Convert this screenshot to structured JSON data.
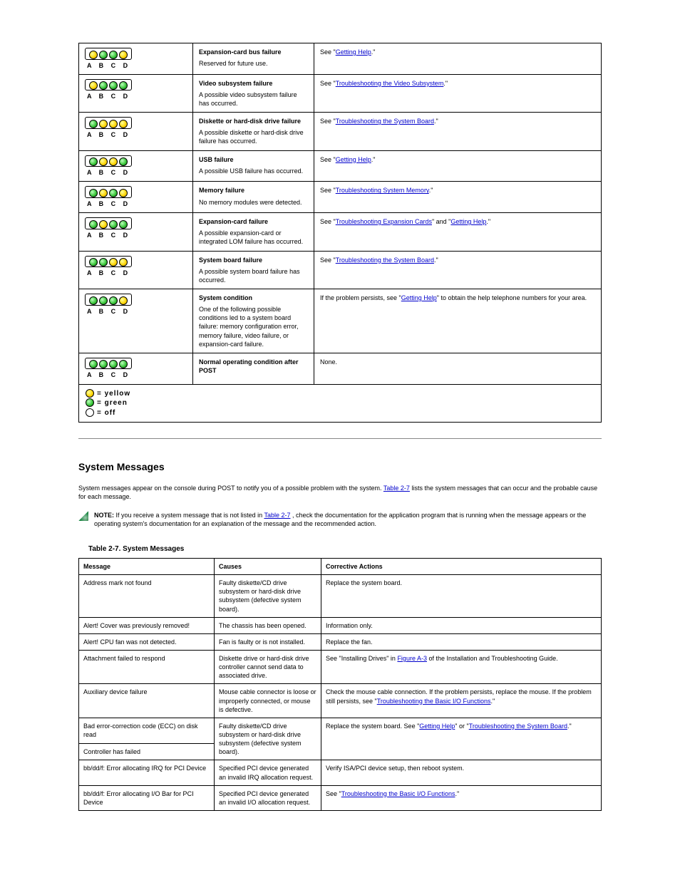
{
  "diag_table": {
    "legend": {
      "yellow": "= yellow",
      "green": "= green",
      "off": "= off"
    },
    "rows": [
      {
        "leds": [
          "y",
          "g",
          "g",
          "y"
        ],
        "cause_title": "Expansion-card bus failure",
        "cause_body": "Reserved for future use.",
        "action": {
          "pre": "See \"",
          "link": "Getting Help",
          "post": ".\""
        }
      },
      {
        "leds": [
          "y",
          "g",
          "g",
          "g"
        ],
        "cause_title": "Video subsystem failure",
        "cause_body": "A possible video subsystem failure has occurred.",
        "action": {
          "pre": "See \"",
          "link": "Troubleshooting the Video Subsystem",
          "post": ".\""
        }
      },
      {
        "leds": [
          "g",
          "y",
          "y",
          "y"
        ],
        "cause_title": "Diskette or hard-disk drive failure",
        "cause_body": "A possible diskette or hard-disk drive failure has occurred.",
        "action": {
          "pre": "See \"",
          "link": "Troubleshooting the System Board",
          "post": ".\""
        }
      },
      {
        "leds": [
          "g",
          "y",
          "y",
          "g"
        ],
        "cause_title": "USB failure",
        "cause_body": "A possible USB failure has occurred.",
        "action": {
          "pre": "See \"",
          "link": "Getting Help",
          "post": ".\""
        }
      },
      {
        "leds": [
          "g",
          "y",
          "g",
          "y"
        ],
        "cause_title": "Memory failure",
        "cause_body": "No memory modules were detected.",
        "action": {
          "pre": "See \"",
          "link": "Troubleshooting System Memory",
          "post": ".\""
        }
      },
      {
        "leds": [
          "g",
          "y",
          "g",
          "g"
        ],
        "cause_title": "Expansion-card failure",
        "cause_body": "A possible expansion-card or integrated LOM failure has occurred.",
        "action": {
          "pre": "See \"",
          "link": "Troubleshooting Expansion Cards",
          "link2": "Getting Help",
          "post2": ".\"",
          "mid": "\" and \""
        }
      },
      {
        "leds": [
          "g",
          "g",
          "y",
          "y"
        ],
        "cause_title": "System board failure",
        "cause_body": "A possible system board failure has occurred.",
        "action": {
          "pre": "See \"",
          "link": "Troubleshooting the System Board",
          "post": ".\""
        }
      },
      {
        "leds": [
          "g",
          "g",
          "g",
          "y"
        ],
        "cause_title": "System condition",
        "cause_body": "One of the following possible conditions led to a system board failure: memory configuration error, memory failure, video failure, or expansion-card failure.",
        "action": {
          "pre": "If the problem persists, see \"",
          "link": "Getting Help",
          "post_special": "\" to obtain the help telephone numbers for your area."
        }
      },
      {
        "leds": [
          "g",
          "g",
          "g",
          "g"
        ],
        "cause_title": "Normal operating condition after POST",
        "cause_body": "",
        "action_plain": "None."
      }
    ]
  },
  "section": {
    "title": "System Messages",
    "intro": {
      "pre": "System messages appear on the console during POST to notify you of a possible problem with the system. ",
      "mid": " lists the system messages that can occur and the probable cause for each message.",
      "link": "Table 2-7"
    },
    "note": {
      "label": "NOTE:",
      "pre": " If you receive a system message that is not listed in ",
      "link": "Table 2-7",
      "post": ", check the documentation for the application program that is running when the message appears or the operating system's documentation for an explanation of the message and the recommended action."
    },
    "table_caption": "Table 2-7. System Messages"
  },
  "msg_table": {
    "headers": {
      "msg": "Message",
      "cause": "Causes",
      "action": "Corrective Actions"
    },
    "rows": [
      {
        "msg": "Address mark not found",
        "cause_html": "Faulty diskette/CD drive subsystem or hard-disk drive subsystem (defective system board).",
        "action": "Replace the system board."
      },
      {
        "msg": "Alert! Cover was previously removed!",
        "cause_html": "The chassis has been opened.",
        "action": "Information only."
      },
      {
        "msg": "Alert! CPU fan was not detected.",
        "cause_html": "Fan is faulty or is not installed.",
        "action": "Replace the fan."
      },
      {
        "msg": "Attachment failed to respond",
        "cause_html": "Diskette drive or hard-disk drive controller cannot send data to associated drive.",
        "action": {
          "pre": "See \"Installing Drives\" in ",
          "link": "Figure A-3",
          "post": " of the Installation and Troubleshooting Guide."
        }
      },
      {
        "msg": "Auxiliary device failure",
        "cause_html": "Mouse cable connector is loose or improperly connected, or mouse is defective.",
        "action": {
          "pre": "Check the mouse cable connection. If the problem persists, replace the mouse. If the problem still persists, see \"",
          "link": "Troubleshooting the Basic I/O Functions",
          "post": ".\""
        }
      },
      {
        "msg": "Bad error-correction code (ECC) on disk read",
        "cause_html": "Faulty diskette/CD drive subsystem or hard-disk drive subsystem (defective system board).",
        "action": {
          "pre": "Replace the system board. See \"",
          "link": "Getting Help",
          "post": "\" or \"",
          "link2": "Troubleshooting the System Board",
          "post2": ".\""
        }
      },
      {
        "msg": "Controller has failed",
        "cause_html": "",
        "action": ""
      },
      {
        "msg": "bb/dd/f: Error allocating IRQ for PCI Device",
        "cause_html": "Specified PCI device generated an invalid IRQ allocation request.",
        "action": {
          "pre": "Verify ISA/PCI device setup, then reboot system.",
          "link": "",
          "post": ""
        }
      },
      {
        "msg": "bb/dd/f: Error allocating I/O Bar for PCI Device",
        "cause_html": "Specified PCI device generated an invalid I/O allocation request.",
        "action": {
          "pre": "See \"",
          "link": "Troubleshooting the Basic I/O Functions",
          "post": ".\""
        }
      }
    ]
  }
}
